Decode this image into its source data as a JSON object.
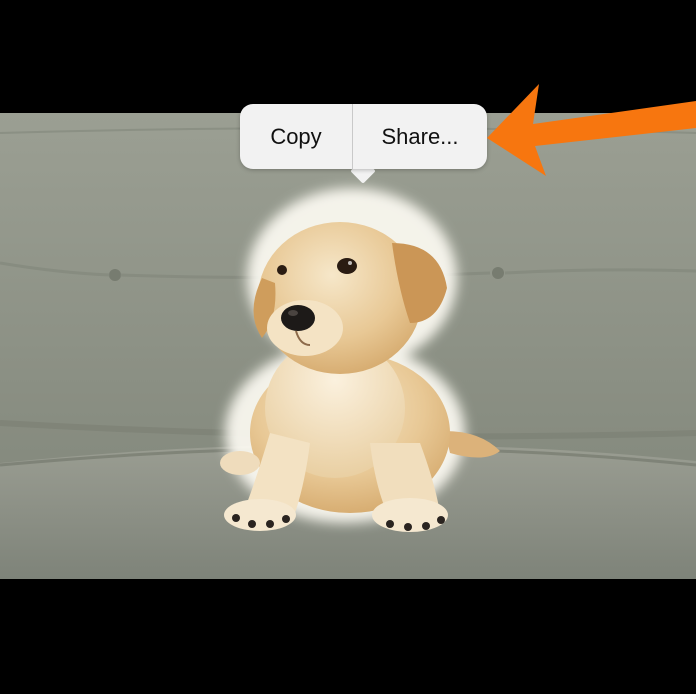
{
  "context_menu": {
    "copy_label": "Copy",
    "share_label": "Share..."
  },
  "colors": {
    "background": "#000000",
    "menu_background": "#f2f2f2",
    "annotation_arrow": "#f7760f"
  },
  "icons": {
    "annotation": "arrow-left-icon"
  }
}
